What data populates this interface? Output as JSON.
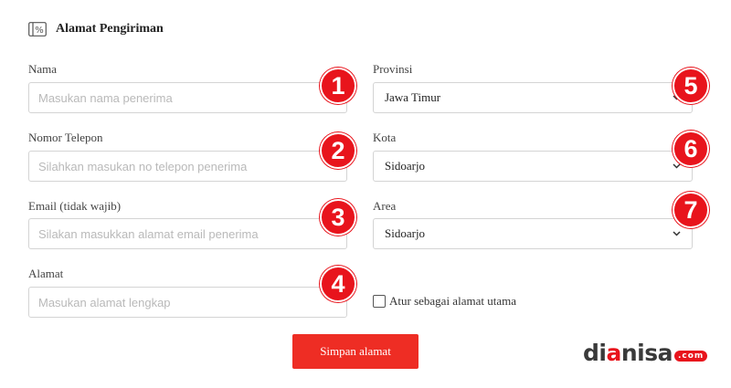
{
  "header": {
    "title": "Alamat Pengiriman",
    "icon": "address-card-icon"
  },
  "form": {
    "nama": {
      "label": "Nama",
      "placeholder": "Masukan nama penerima",
      "value": ""
    },
    "telepon": {
      "label": "Nomor Telepon",
      "placeholder": "Silahkan masukan no telepon penerima",
      "value": ""
    },
    "email": {
      "label": "Email (tidak wajib)",
      "placeholder": "Silakan masukkan alamat email penerima",
      "value": ""
    },
    "alamat": {
      "label": "Alamat",
      "placeholder": "Masukan alamat lengkap",
      "value": ""
    },
    "provinsi": {
      "label": "Provinsi",
      "selected": "Jawa Timur"
    },
    "kota": {
      "label": "Kota",
      "selected": "Sidoarjo"
    },
    "area": {
      "label": "Area",
      "selected": "Sidoarjo"
    },
    "default_address": {
      "label": "Atur sebagai alamat utama",
      "checked": false
    },
    "save_label": "Simpan alamat"
  },
  "badges": {
    "b1": "1",
    "b2": "2",
    "b3": "3",
    "b4": "4",
    "b5": "5",
    "b6": "6",
    "b7": "7"
  },
  "watermark": {
    "part1": "di",
    "part2": "a",
    "part3": "nisa",
    "dotcom": ".com"
  },
  "colors": {
    "accent": "#ee2d24",
    "badge": "#e8141c",
    "border": "#d4d4d4",
    "placeholder": "#b9b9b9"
  }
}
